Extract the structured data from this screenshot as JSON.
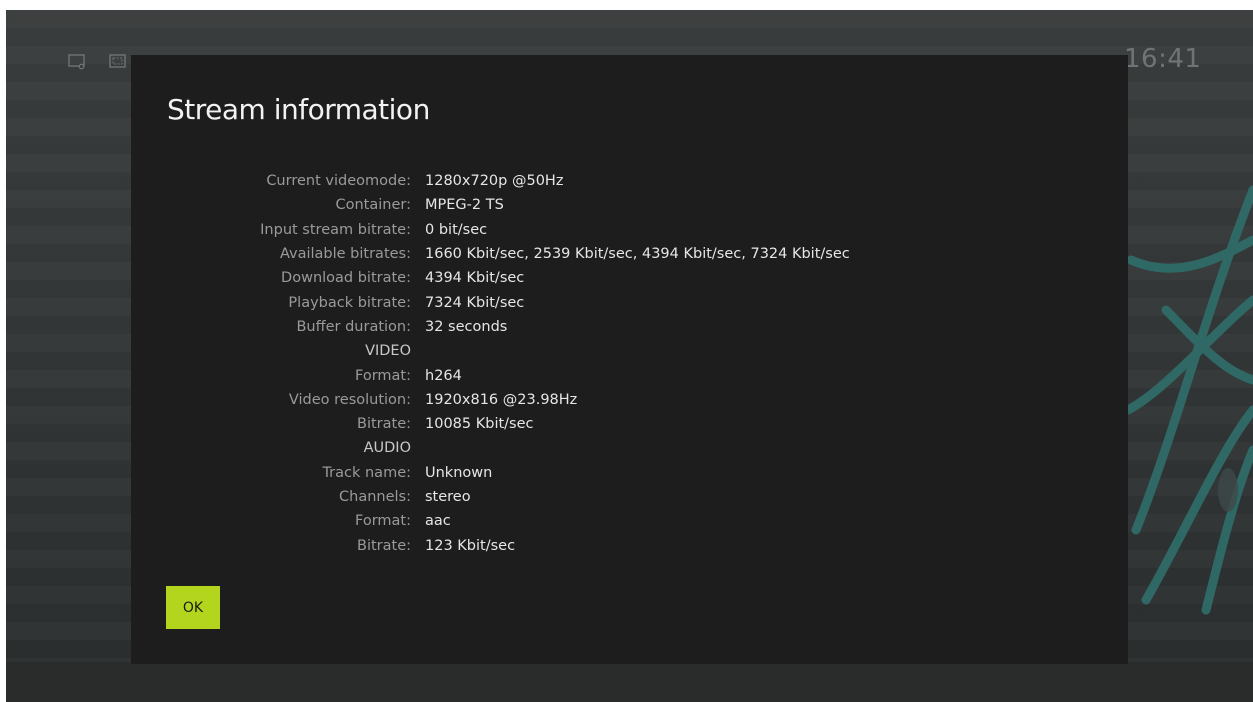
{
  "topbar": {
    "icons": [
      "cast-icon",
      "fullscreen-icon"
    ],
    "clock": "16:41"
  },
  "dialog": {
    "title": "Stream information",
    "rows": [
      {
        "label": "Current videomode:",
        "value": "1280x720p @50Hz"
      },
      {
        "label": "Container:",
        "value": "MPEG-2 TS"
      },
      {
        "label": "Input stream bitrate:",
        "value": "0 bit/sec"
      },
      {
        "label": "Available bitrates:",
        "value": "1660 Kbit/sec, 2539 Kbit/sec, 4394 Kbit/sec, 7324 Kbit/sec"
      },
      {
        "label": "Download bitrate:",
        "value": "4394 Kbit/sec"
      },
      {
        "label": "Playback bitrate:",
        "value": "7324 Kbit/sec"
      },
      {
        "label": "Buffer duration:",
        "value": "32 seconds"
      },
      {
        "label": "VIDEO",
        "value": "",
        "section": true
      },
      {
        "label": "Format:",
        "value": "h264"
      },
      {
        "label": "Video resolution:",
        "value": "1920x816 @23.98Hz"
      },
      {
        "label": "Bitrate:",
        "value": "10085 Kbit/sec"
      },
      {
        "label": "AUDIO",
        "value": "",
        "section": true
      },
      {
        "label": "Track name:",
        "value": "Unknown"
      },
      {
        "label": "Channels:",
        "value": "stereo"
      },
      {
        "label": "Format:",
        "value": "aac"
      },
      {
        "label": "Bitrate:",
        "value": "123 Kbit/sec"
      }
    ],
    "ok_label": "OK"
  },
  "colors": {
    "accent": "#b4d51e",
    "dialog_bg": "#1d1d1d",
    "background": "#343838",
    "teal_art": "#2f6e6a"
  }
}
